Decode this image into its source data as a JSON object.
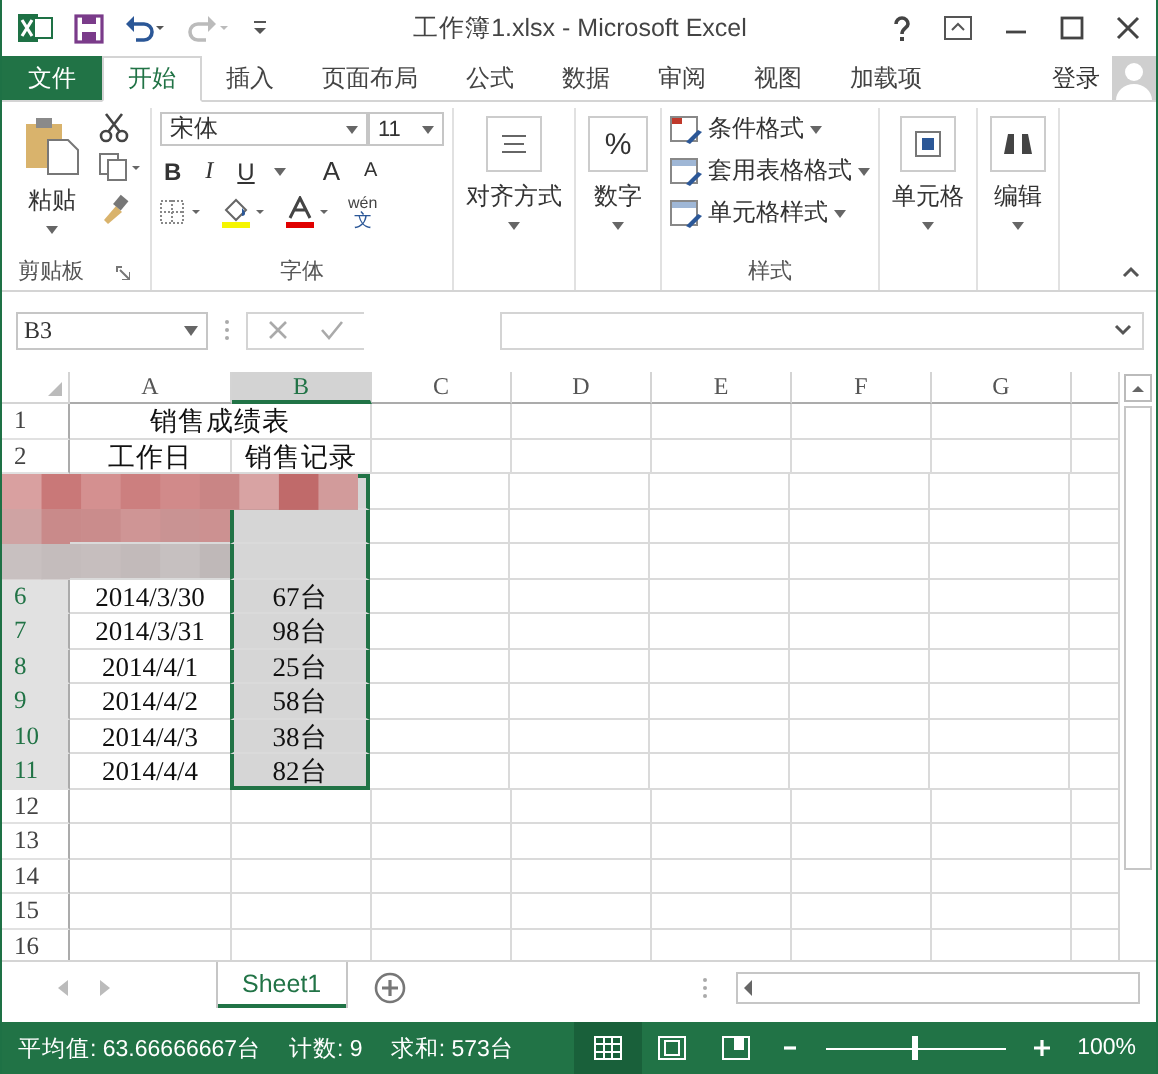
{
  "window": {
    "title": "工作簿1.xlsx - Microsoft Excel"
  },
  "tabs": [
    {
      "label": "文件",
      "kind": "file",
      "selected": false
    },
    {
      "label": "开始",
      "kind": "tab",
      "selected": true
    },
    {
      "label": "插入",
      "kind": "tab",
      "selected": false
    },
    {
      "label": "页面布局",
      "kind": "tab",
      "selected": false
    },
    {
      "label": "公式",
      "kind": "tab",
      "selected": false
    },
    {
      "label": "数据",
      "kind": "tab",
      "selected": false
    },
    {
      "label": "审阅",
      "kind": "tab",
      "selected": false
    },
    {
      "label": "视图",
      "kind": "tab",
      "selected": false
    },
    {
      "label": "加载项",
      "kind": "tab",
      "selected": false
    }
  ],
  "account": {
    "label": "登录"
  },
  "ribbon": {
    "clipboard": {
      "paste": "粘贴",
      "label": "剪贴板"
    },
    "font": {
      "font_name": "宋体",
      "font_size": "11",
      "style_buttons": [
        "B",
        "I",
        "U"
      ],
      "size_buttons": [
        "A",
        "A"
      ],
      "phonetic": "wén",
      "phonetic_char": "文",
      "label": "字体"
    },
    "alignment": {
      "label": "对齐方式"
    },
    "number": {
      "symbol": "%",
      "label": "数字"
    },
    "styles": {
      "items": [
        "条件格式",
        "套用表格格式",
        "单元格样式"
      ],
      "label": "样式"
    },
    "cells": {
      "label": "单元格"
    },
    "editing": {
      "label": "编辑"
    }
  },
  "formula_bar": {
    "name_box": "B3"
  },
  "columns": [
    {
      "label": "A",
      "selected": false
    },
    {
      "label": "B",
      "selected": true
    },
    {
      "label": "C",
      "selected": false
    },
    {
      "label": "D",
      "selected": false
    },
    {
      "label": "E",
      "selected": false
    },
    {
      "label": "F",
      "selected": false
    },
    {
      "label": "G",
      "selected": false
    }
  ],
  "rows": [
    {
      "header": "1",
      "kind": "merged",
      "text": "销售成绩表",
      "selected": false
    },
    {
      "header": "2",
      "kind": "data",
      "cells": [
        "工作日",
        "销售记录"
      ],
      "selected": false
    },
    {
      "kind": "obscured",
      "selected": true
    },
    {
      "kind": "obscured",
      "selected": true
    },
    {
      "kind": "obscured",
      "selected": true
    },
    {
      "header": "6",
      "kind": "data",
      "cells": [
        "2014/3/30",
        "67台"
      ],
      "selected": true
    },
    {
      "header": "7",
      "kind": "data",
      "cells": [
        "2014/3/31",
        "98台"
      ],
      "selected": true
    },
    {
      "header": "8",
      "kind": "data",
      "cells": [
        "2014/4/1",
        "25台"
      ],
      "selected": true
    },
    {
      "header": "9",
      "kind": "data",
      "cells": [
        "2014/4/2",
        "58台"
      ],
      "selected": true
    },
    {
      "header": "10",
      "kind": "data",
      "cells": [
        "2014/4/3",
        "38台"
      ],
      "selected": true
    },
    {
      "header": "11",
      "kind": "data",
      "cells": [
        "2014/4/4",
        "82台"
      ],
      "selected": true
    },
    {
      "header": "12",
      "kind": "empty",
      "selected": false
    },
    {
      "header": "13",
      "kind": "empty",
      "selected": false
    },
    {
      "header": "14",
      "kind": "empty",
      "selected": false
    },
    {
      "header": "15",
      "kind": "empty",
      "selected": false
    },
    {
      "header": "16",
      "kind": "empty",
      "selected": false
    }
  ],
  "sheets": [
    {
      "label": "Sheet1",
      "selected": true
    }
  ],
  "status_bar": {
    "average": "平均值: 63.66666667台",
    "count": "计数: 9",
    "sum": "求和: 573台",
    "views": [
      {
        "kind": "normal",
        "selected": true
      },
      {
        "kind": "page_layout",
        "selected": false
      },
      {
        "kind": "page_break",
        "selected": false
      }
    ],
    "zoom": {
      "level": 0.5,
      "reading": "100%"
    }
  }
}
